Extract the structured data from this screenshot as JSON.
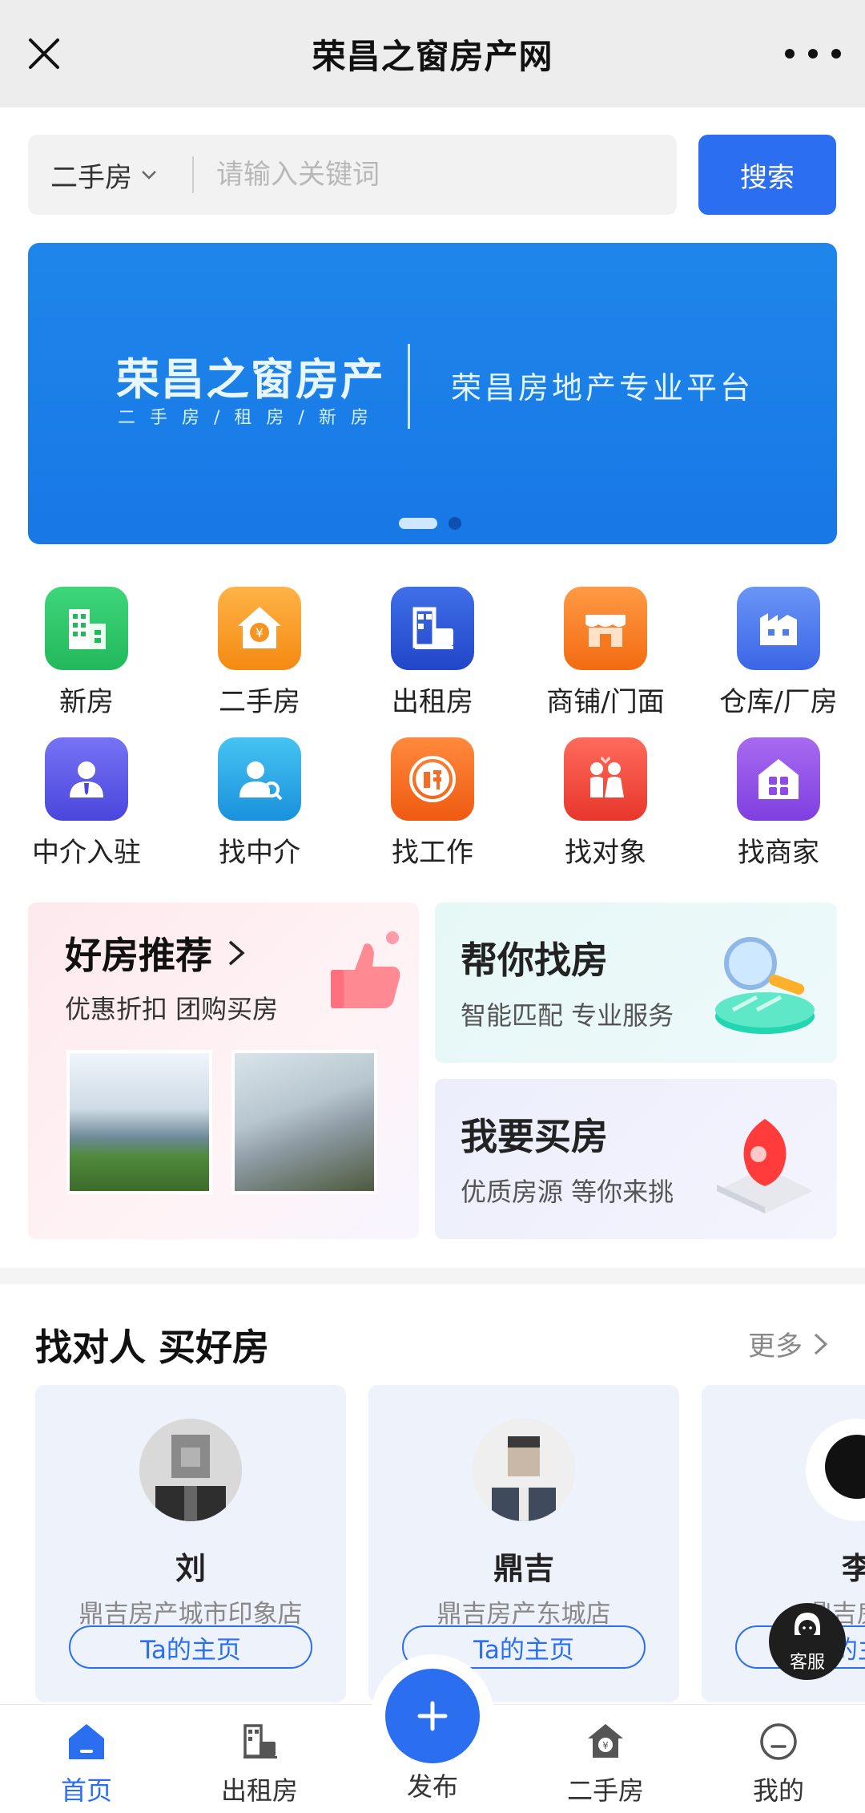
{
  "header": {
    "title": "荣昌之窗房产网"
  },
  "search": {
    "type": "二手房",
    "placeholder": "请输入关键词",
    "button": "搜索"
  },
  "banner": {
    "title": "荣昌之窗房产",
    "subtitle": "二手房/租房/新房",
    "slogan": "荣昌房地产专业平台"
  },
  "grid": [
    {
      "label": "新房",
      "icon": "building-icon",
      "color": "#29c466"
    },
    {
      "label": "二手房",
      "icon": "house-coin-icon",
      "color": "#f7931e"
    },
    {
      "label": "出租房",
      "icon": "rent-icon",
      "color": "#2b5bd7"
    },
    {
      "label": "商铺/门面",
      "icon": "shop-icon",
      "color": "#f6781d"
    },
    {
      "label": "仓库/厂房",
      "icon": "factory-icon",
      "color": "#4d7cf2"
    },
    {
      "label": "中介入驻",
      "icon": "agent-icon",
      "color": "#5b56e8"
    },
    {
      "label": "找中介",
      "icon": "find-agent-icon",
      "color": "#26a7e8"
    },
    {
      "label": "找工作",
      "icon": "job-icon",
      "color": "#f56a24"
    },
    {
      "label": "找对象",
      "icon": "couple-icon",
      "color": "#f24b3f"
    },
    {
      "label": "找商家",
      "icon": "merchant-icon",
      "color": "#8f4be6"
    }
  ],
  "promo": {
    "left": {
      "title": "好房推荐",
      "subtitle": "优惠折扣 团购买房"
    },
    "right_top": {
      "title": "帮你找房",
      "subtitle": "智能匹配 专业服务"
    },
    "right_bottom": {
      "title": "我要买房",
      "subtitle": "优质房源 等你来挑"
    }
  },
  "agents_section": {
    "title": "找对人 买好房",
    "more": "更多"
  },
  "agents": [
    {
      "name": "刘",
      "store": "鼎吉房产城市印象店",
      "button": "Ta的主页"
    },
    {
      "name": "鼎吉",
      "store": "鼎吉房产东城店",
      "button": "Ta的主页"
    },
    {
      "name": "李",
      "store": "鼎吉房产",
      "button": "Ta的主页"
    }
  ],
  "service": {
    "label": "客服"
  },
  "nav": {
    "items": [
      {
        "label": "首页",
        "icon": "home-icon"
      },
      {
        "label": "出租房",
        "icon": "rent-nav-icon"
      },
      {
        "label": "发布",
        "icon": "plus-icon"
      },
      {
        "label": "二手房",
        "icon": "house-nav-icon"
      },
      {
        "label": "我的",
        "icon": "profile-icon"
      }
    ]
  },
  "colors": {
    "accent": "#2b6ff0",
    "banner": "#1e86ea"
  }
}
